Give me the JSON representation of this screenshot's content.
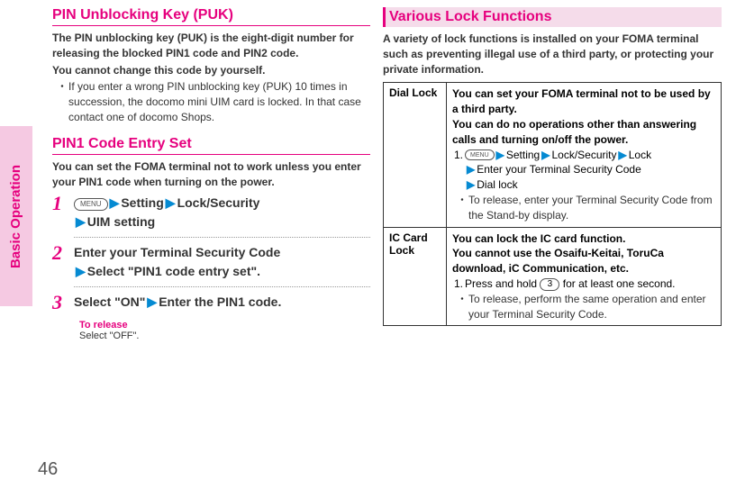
{
  "sidebar": {
    "label": "Basic Operation"
  },
  "pageNumber": "46",
  "left": {
    "sec1": {
      "title": "PIN Unblocking Key (PUK)",
      "p1": "The PIN unblocking key (PUK) is the eight-digit number for releasing the blocked PIN1 code and PIN2 code.",
      "p2": "You cannot change this code by yourself.",
      "b1": "If you enter a wrong PIN unblocking key (PUK) 10 times in succession, the docomo mini UIM card is locked. In that case contact one of docomo Shops."
    },
    "sec2": {
      "title": "PIN1 Code Entry Set",
      "p1": "You can set the FOMA terminal not to work unless you enter your PIN1 code when turning on the power.",
      "step1": {
        "num": "1",
        "menu": "MENU",
        "setting": "Setting",
        "lock": "Lock/Security",
        "uim": "UIM setting"
      },
      "step2": {
        "num": "2",
        "l1": "Enter your Terminal Security Code",
        "l2": "Select \"PIN1 code entry set\"."
      },
      "step3": {
        "num": "3",
        "l1": "Select \"ON\"",
        "l2": "Enter the PIN1 code."
      },
      "release": {
        "title": "To release",
        "body": "Select \"OFF\"."
      }
    }
  },
  "right": {
    "title": "Various Lock Functions",
    "p1": "A variety of lock functions is installed on your FOMA terminal such as preventing illegal use of a third party, or protecting your private information.",
    "row1": {
      "label": "Dial Lock",
      "b1": "You can set your FOMA terminal not to be used by a third party.",
      "b2": "You can do no operations other than answering calls and turning on/off the power.",
      "step_num": "1.",
      "menu": "MENU",
      "s_setting": "Setting",
      "s_lock": "Lock/Security",
      "s_lock2": "Lock",
      "s_enter": "Enter your Terminal Security Code",
      "s_dial": "Dial lock",
      "bullet": "To release, enter your Terminal Security Code from the Stand-by display."
    },
    "row2": {
      "label": "IC Card Lock",
      "b1": "You can lock the IC card function.",
      "b2": "You cannot use the Osaifu-Keitai, ToruCa download, iC Communication, etc.",
      "step_num": "1.",
      "s_press_a": "Press and hold",
      "key": "3",
      "s_press_b": "for at least one second.",
      "bullet": "To release, perform the same operation and enter your Terminal Security Code."
    }
  }
}
